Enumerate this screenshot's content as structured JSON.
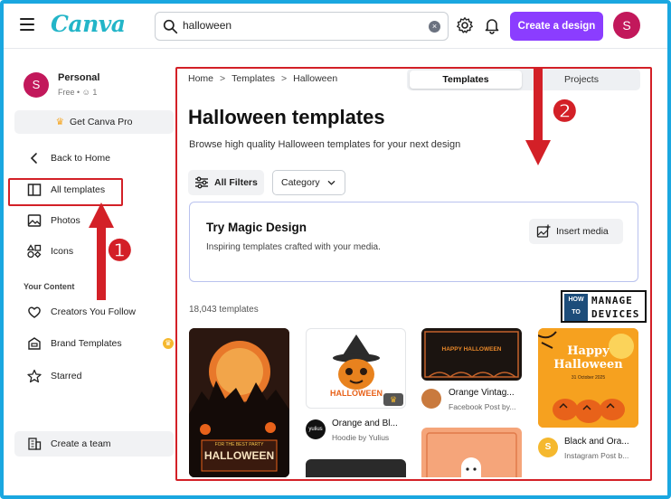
{
  "header": {
    "logo": "Canva",
    "search_value": "halloween",
    "clear_icon": "×",
    "create_label": "Create a design",
    "avatar_initial": "S",
    "brand_color": "#8b3dff"
  },
  "sidebar": {
    "profile": {
      "initial": "S",
      "name": "Personal",
      "sub": "Free • ☺ 1"
    },
    "pro_label": "Get Canva Pro",
    "back_label": "Back to Home",
    "items": [
      {
        "label": "All templates",
        "icon": "template-icon"
      },
      {
        "label": "Photos",
        "icon": "image-icon"
      },
      {
        "label": "Icons",
        "icon": "shapes-icon"
      }
    ],
    "section_label": "Your Content",
    "content_items": [
      {
        "label": "Creators You Follow",
        "icon": "heart-icon"
      },
      {
        "label": "Brand Templates",
        "icon": "brand-icon",
        "badge": "♛"
      },
      {
        "label": "Starred",
        "icon": "star-icon"
      }
    ],
    "team_label": "Create a team"
  },
  "main": {
    "breadcrumb": [
      "Home",
      "Templates",
      "Halloween"
    ],
    "breadcrumb_sep": ">",
    "tabs": [
      {
        "label": "Templates",
        "active": true
      },
      {
        "label": "Projects",
        "active": false
      }
    ],
    "title": "Halloween templates",
    "subtitle": "Browse high quality Halloween templates for your next design",
    "filters_label": "All Filters",
    "category_label": "Category",
    "magic": {
      "title": "Try Magic Design",
      "subtitle": "Inspiring templates crafted with your media.",
      "button": "Insert media"
    },
    "count": "18,043 templates",
    "templates": [
      {
        "poster_text_1": "FOR THE BEST PARTY",
        "poster_text_2": "HALLOWEEN"
      },
      {
        "title": "Orange and Bl...",
        "sub": "Hoodie by Yulius",
        "art_text": "HALLOWEEN",
        "avatar_text": "yulius"
      },
      {
        "title": "Orange Vintag...",
        "sub": "Facebook Post by...",
        "art_text": "HAPPY HALLOWEEN"
      },
      {
        "title": "Black and Ora...",
        "sub": "Instagram Post b...",
        "art_line_1": "Happy",
        "art_line_2": "Halloween",
        "art_date": "31 October 2025",
        "avatar_initial": "S"
      }
    ]
  },
  "watermark": {
    "how": "HOW",
    "to": "TO",
    "line1": "MANAGE",
    "line2": "DEVICES"
  },
  "annotations": {
    "one": "❶",
    "two": "❷",
    "color": "#d32027"
  }
}
